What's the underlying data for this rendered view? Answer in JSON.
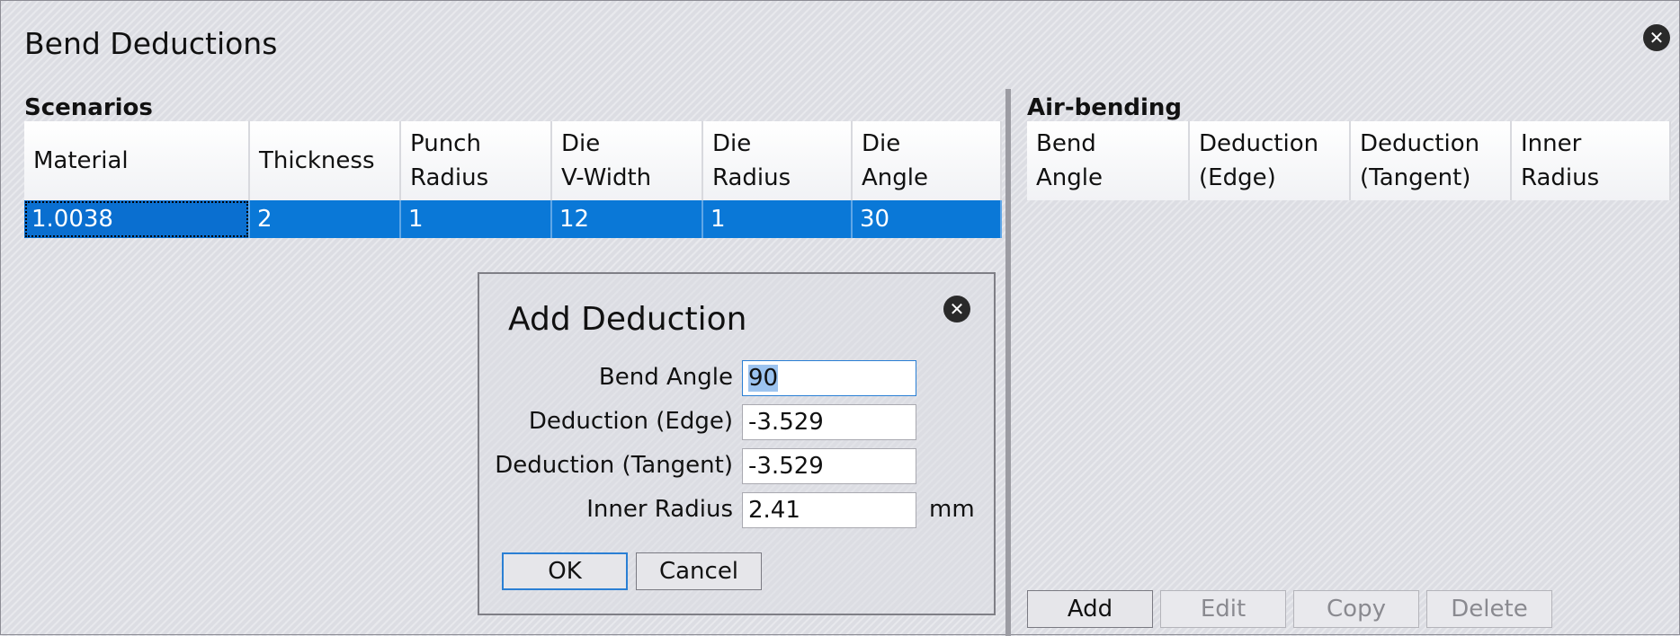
{
  "window": {
    "title": "Bend Deductions"
  },
  "scenarios": {
    "label": "Scenarios",
    "columns": [
      {
        "line1": "Material",
        "line2": ""
      },
      {
        "line1": "Thickness",
        "line2": ""
      },
      {
        "line1": "Punch",
        "line2": "Radius"
      },
      {
        "line1": "Die",
        "line2": "V-Width"
      },
      {
        "line1": "Die",
        "line2": "Radius"
      },
      {
        "line1": "Die",
        "line2": "Angle"
      }
    ],
    "rows": [
      [
        "1.0038",
        "2",
        "1",
        "12",
        "1",
        "30"
      ]
    ]
  },
  "air_bending": {
    "label": "Air-bending",
    "columns": [
      {
        "line1": "Bend",
        "line2": "Angle"
      },
      {
        "line1": "Deduction",
        "line2": "(Edge)"
      },
      {
        "line1": "Deduction",
        "line2": "(Tangent)"
      },
      {
        "line1": "Inner",
        "line2": "Radius"
      }
    ],
    "buttons": {
      "add": "Add",
      "edit": "Edit",
      "copy": "Copy",
      "delete": "Delete"
    }
  },
  "dialog": {
    "title": "Add Deduction",
    "fields": {
      "bend_angle": {
        "label": "Bend Angle",
        "value": "90"
      },
      "deduction_edge": {
        "label": "Deduction (Edge)",
        "value": "-3.529"
      },
      "deduction_tangent": {
        "label": "Deduction (Tangent)",
        "value": "-3.529"
      },
      "inner_radius": {
        "label": "Inner Radius",
        "value": "2.41",
        "unit": "mm"
      }
    },
    "buttons": {
      "ok": "OK",
      "cancel": "Cancel"
    }
  },
  "icons": {
    "close": "close-icon"
  },
  "colors": {
    "selection": "#0a78d7",
    "focus_border": "#2a7fd4"
  }
}
